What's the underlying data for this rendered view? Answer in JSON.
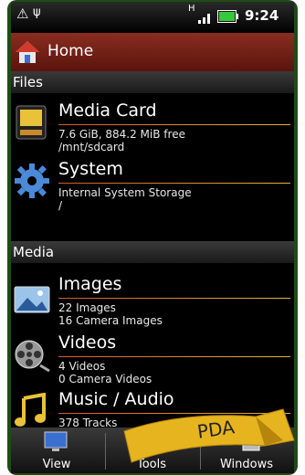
{
  "statusbar": {
    "signal_letter": "H",
    "time": "9:24"
  },
  "appbar": {
    "title": "Home"
  },
  "sections": {
    "files": "Files",
    "media": "Media"
  },
  "items": {
    "media_card": {
      "title": "Media Card",
      "line1": "7.6 GiB, 884.2 MiB free",
      "line2": "/mnt/sdcard"
    },
    "system": {
      "title": "System",
      "line1": "Internal System Storage",
      "line2": "/"
    },
    "images": {
      "title": "Images",
      "line1": "22 Images",
      "line2": "16 Camera Images"
    },
    "videos": {
      "title": "Videos",
      "line1": "4 Videos",
      "line2": "0 Camera Videos"
    },
    "music": {
      "title": "Music / Audio",
      "line1": "378 Tracks"
    }
  },
  "bottom": {
    "view": "View",
    "tools": "Tools",
    "windows": "Windows"
  },
  "ribbon": {
    "text": "PDA"
  },
  "colors": {
    "appbar": "#7a2418",
    "accent_line": "#e5b531",
    "device": "#1d4d16"
  }
}
